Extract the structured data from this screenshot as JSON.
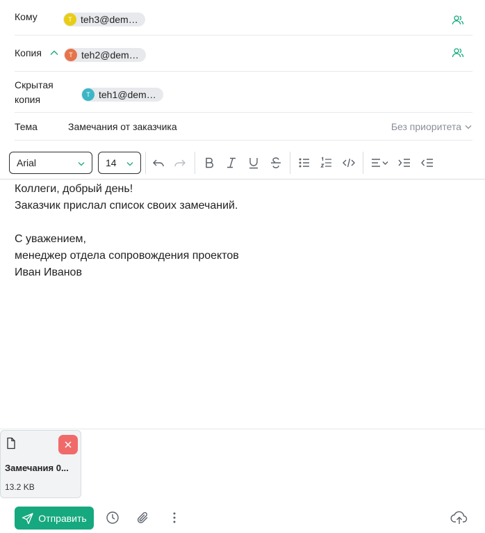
{
  "to": {
    "label": "Кому",
    "recipients": [
      {
        "initial": "T",
        "email": "teh3@dem…",
        "color": "#e8cd15"
      }
    ]
  },
  "cc": {
    "label": "Копия",
    "recipients": [
      {
        "initial": "T",
        "email": "teh2@dem…",
        "color": "#e6744a"
      }
    ]
  },
  "bcc": {
    "label_line1": "Скрытая",
    "label_line2": "копия",
    "recipients": [
      {
        "initial": "T",
        "email": "teh1@dem…",
        "color": "#3cb6c6"
      }
    ]
  },
  "subject": {
    "label": "Тема",
    "value": "Замечания от заказчика",
    "priority": "Без приоритета"
  },
  "toolbar": {
    "font_family": "Arial",
    "font_size": "14"
  },
  "body": {
    "lines": [
      "Коллеги, добрый день!",
      "Заказчик прислал список своих замечаний.",
      "",
      "С уважением,",
      "менеджер отдела сопровождения проектов",
      "Иван Иванов"
    ]
  },
  "attachment": {
    "name": "Замечания 0...",
    "size": "13.2 KB"
  },
  "footer": {
    "send_label": "Отправить"
  },
  "colors": {
    "accent": "#16a87e",
    "danger": "#f06a6a"
  }
}
